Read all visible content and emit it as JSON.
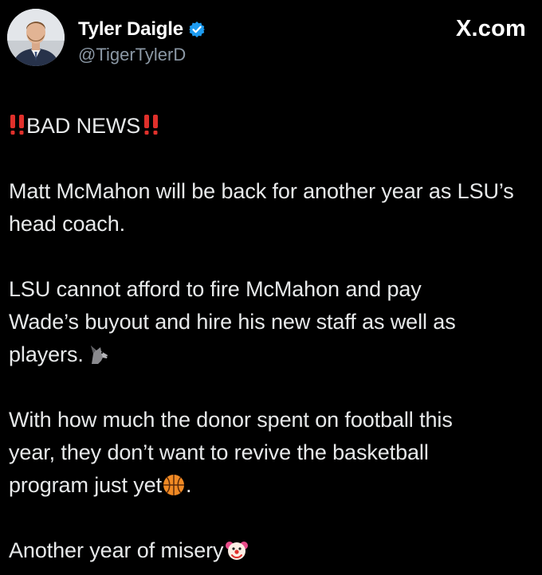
{
  "header": {
    "display_name": "Tyler Daigle",
    "handle": "@TigerTylerD",
    "site": "X.com",
    "verified_color": "#1d9bf0"
  },
  "tweet": {
    "headline_text": "BAD NEWS",
    "headline_emoji": "double-exclamation-icon",
    "para1": "Matt McMahon will be back for another year as LSU’s head coach.",
    "para2_line1": "LSU cannot afford to fire McMahon and pay",
    "para2_line2": "Wade’s buyout and hire his new staff as well as",
    "para2_line3": "players.",
    "para2_emoji": "wolf-icon",
    "para3_line1": "With how much the donor spent on football this",
    "para3_line2": "year, they don’t want to revive the basketball",
    "para3_line3a": "program just yet",
    "para3_line3b": ".",
    "para3_emoji": "basketball-icon",
    "para4": "Another year of misery",
    "para4_emoji": "clown-face-icon"
  },
  "colors": {
    "background": "#000000",
    "text": "#e7e9ea",
    "muted": "#8b98a5",
    "alert_red": "#e0302b"
  }
}
